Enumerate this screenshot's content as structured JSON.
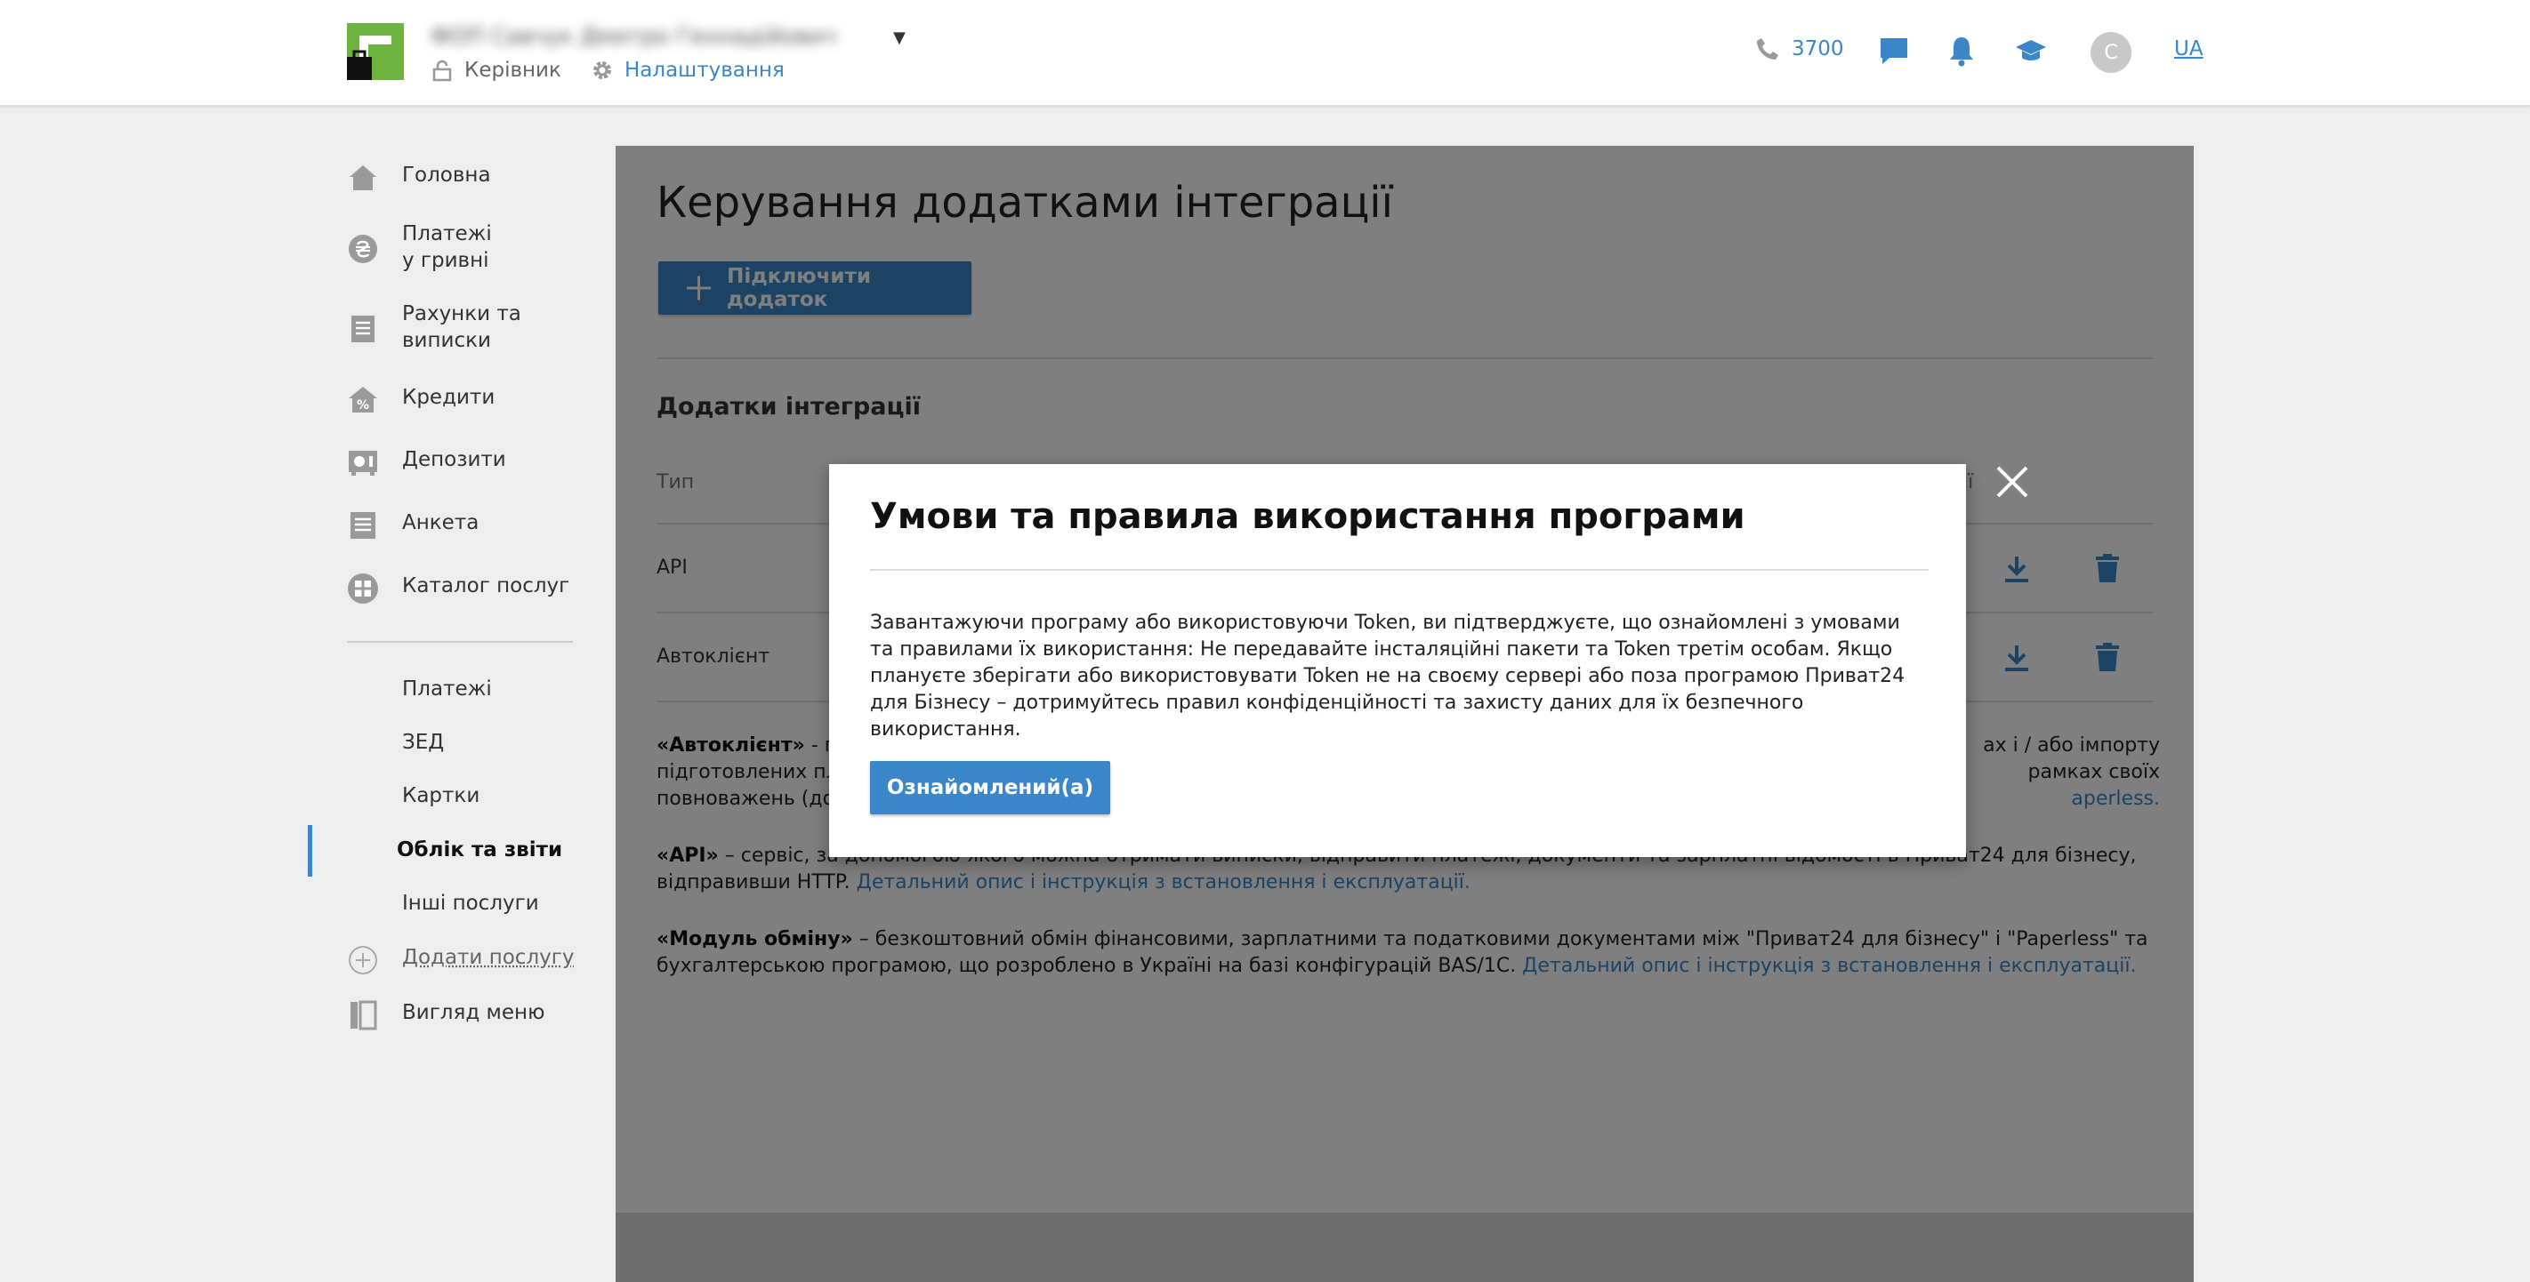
{
  "header": {
    "company_name": "ФОП Савчук Дмитро Геннадійович",
    "role": "Керівник",
    "settings": "Налаштування",
    "phone": "3700",
    "avatar_letter": "С",
    "lang": "UA"
  },
  "sidebar": {
    "items": [
      {
        "label": "Головна",
        "icon": "home-icon"
      },
      {
        "label": "Платежі\nу гривні",
        "icon": "hryvnia-icon"
      },
      {
        "label": "Рахунки та\nвиписки",
        "icon": "document-icon"
      },
      {
        "label": "Кредити",
        "icon": "house-percent-icon"
      },
      {
        "label": "Депозити",
        "icon": "deposit-icon"
      },
      {
        "label": "Анкета",
        "icon": "form-icon"
      },
      {
        "label": "Каталог послуг",
        "icon": "catalog-icon"
      }
    ],
    "sub_items": [
      "Платежі",
      "ЗЕД",
      "Картки",
      "Облік та звіти",
      "Інші послуги"
    ],
    "add_service": "Додати послугу",
    "menu_view": "Вигляд меню"
  },
  "main": {
    "title": "Керування додатками інтеграції",
    "connect_button": "Підключити додаток",
    "section_title": "Додатки інтеграції",
    "col_type": "Тип",
    "col_actions_partial": "ії",
    "rows": [
      "API",
      "Автоклієнт"
    ],
    "row_cut": "А",
    "desc1_bold": "«Автоклієнт»",
    "desc1_line1_left": " - пр",
    "desc1_line1_right": "ах і / або імпорту",
    "desc1_line2_left": "підготовлених пла",
    "desc1_line2_right": "рамках своїх",
    "desc1_line3_left": "повноважень (дос",
    "desc1_line3_link": "aperless.",
    "desc2_bold": "«API»",
    "desc2_text": " – сервіс, за допомогою якого можна отримати виписки, відправити платежі, документи та зарплатні відомості в Приват24 для бізнесу, відправивши HTTP.",
    "desc2_link": " Детальний опис і інструкція з встановлення і експлуатації.",
    "desc3_bold": "«Модуль обміну»",
    "desc3_text": " – безкоштовний обмін фінансовими, зарплатними та податковими документами між \"Приват24 для бізнесу\" і \"Paperless\" та бухгалтерською програмою, що розроблено в Україні на базі конфігурацій BAS/1С.",
    "desc3_link": " Детальний опис і інструкція з встановлення і експлуатації."
  },
  "modal": {
    "title": "Умови та правила використання програми",
    "text": "Завантажуючи програму або використовуючи Token, ви підтверджуєте, що ознайомлені з умовами та правилами їх використання: Не передавайте інсталяційні пакети та Token третім особам. Якщо плануєте зберігати або використовувати Token не на своєму сервері або поза програмою Приват24 для Бізнесу – дотримуйтесь правил конфіденційності та захисту даних для їх безпечного використання.",
    "ack_button": "Ознайомлений(а)"
  },
  "colors": {
    "accent": "#3a86c8",
    "logo_green": "#6db33f",
    "icon_gray": "#9a9a9a"
  }
}
